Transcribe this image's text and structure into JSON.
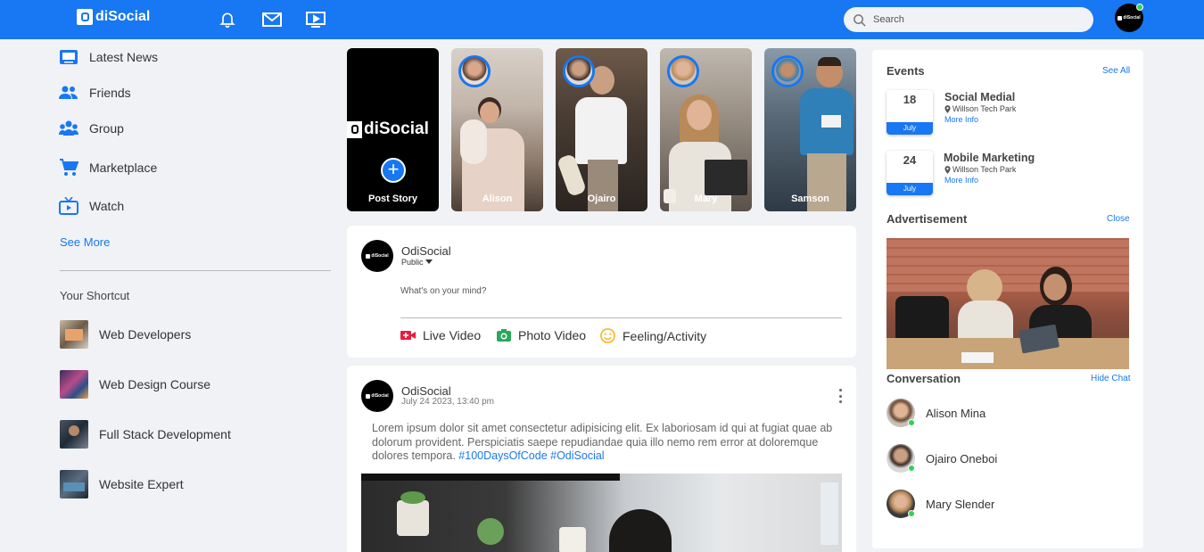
{
  "header": {
    "logo_text": "diSocial",
    "search_placeholder": "Search",
    "icons": [
      "bell-icon",
      "mail-icon",
      "video-icon"
    ]
  },
  "sidebar": {
    "items": [
      {
        "label": "Latest News",
        "icon": "news-icon"
      },
      {
        "label": "Friends",
        "icon": "friends-icon"
      },
      {
        "label": "Group",
        "icon": "group-icon"
      },
      {
        "label": "Marketplace",
        "icon": "cart-icon"
      },
      {
        "label": "Watch",
        "icon": "tv-icon"
      }
    ],
    "see_more": "See More",
    "shortcut_title": "Your Shortcut",
    "shortcuts": [
      {
        "label": "Web Developers"
      },
      {
        "label": "Web Design Course"
      },
      {
        "label": "Full Stack Development"
      },
      {
        "label": "Website Expert"
      }
    ]
  },
  "stories": {
    "post_logo_text": "diSocial",
    "post_label": "Post Story",
    "items": [
      {
        "name": "Alison"
      },
      {
        "name": "Ojairo"
      },
      {
        "name": "Mary"
      },
      {
        "name": "Samson"
      }
    ]
  },
  "composer": {
    "name": "OdiSocial",
    "privacy": "Public",
    "placeholder": "What's on your mind?",
    "actions": [
      {
        "label": "Live Video",
        "icon": "live-video-icon",
        "color": "#e41e3f"
      },
      {
        "label": "Photo Video",
        "icon": "photo-icon",
        "color": "#2aa85b"
      },
      {
        "label": "Feeling/Activity",
        "icon": "smile-icon",
        "color": "#f7b928"
      }
    ]
  },
  "post": {
    "name": "OdiSocial",
    "time": "July 24 2023, 13:40 pm",
    "text": "Lorem ipsum dolor sit amet consectetur adipisicing elit. Ex laboriosam id qui at fugiat quae ab dolorum provident. Perspiciatis saepe repudiandae quia illo nemo rem error at doloremque dolores tempora.",
    "tags": "#100DaysOfCode #OdiSocial"
  },
  "events": {
    "title": "Events",
    "see_all": "See All",
    "items": [
      {
        "day": "18",
        "month": "July",
        "title": "Social Medial",
        "location": "Willson Tech Park",
        "more": "More Info"
      },
      {
        "day": "24",
        "month": "July",
        "title": "Mobile Marketing",
        "location": "Willson Tech Park",
        "more": "More Info"
      }
    ]
  },
  "advertisement": {
    "title": "Advertisement",
    "close": "Close"
  },
  "conversation": {
    "title": "Conversation",
    "hide": "Hide Chat",
    "items": [
      {
        "name": "Alison Mina"
      },
      {
        "name": "Ojairo Oneboi"
      },
      {
        "name": "Mary Slender"
      }
    ]
  },
  "colors": {
    "brand": "#1877f2",
    "background": "#f0f2f5",
    "online": "#31d158"
  }
}
